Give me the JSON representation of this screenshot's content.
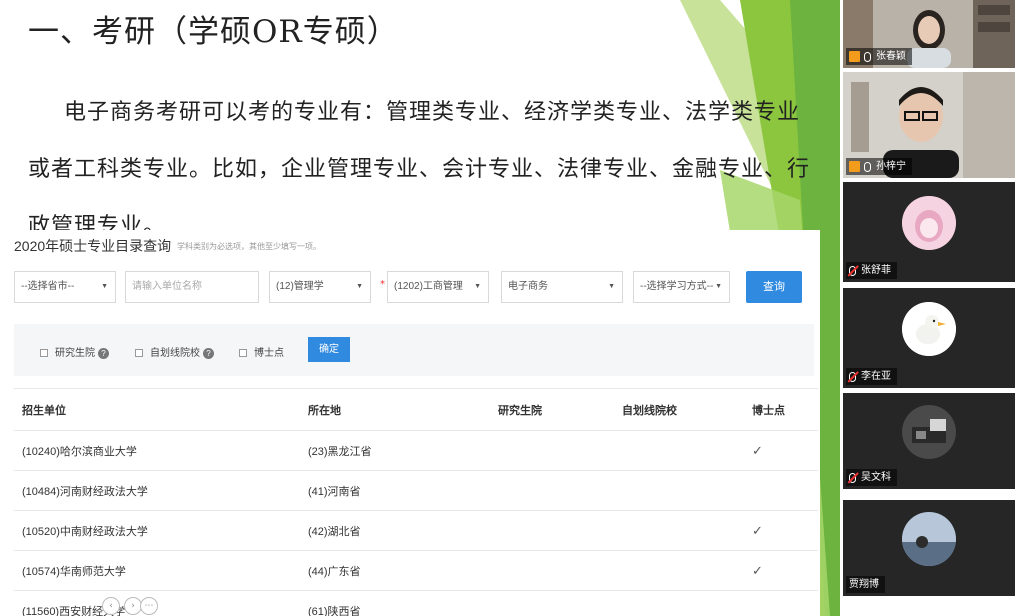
{
  "slide": {
    "title": "一、考研（学硕OR专硕）",
    "paragraph": "电子商务考研可以考的专业有：管理类专业、经济学类专业、法学类专业或者工科类专业。比如，企业管理专业、会计专业、法律专业、金融专业、行政管理专业。"
  },
  "webpage": {
    "title": "2020年硕士专业目录查询",
    "hint": "学科类别为必选项，其他至少填写一项。",
    "filters": {
      "province": "--选择省市--",
      "unit_placeholder": "请输入单位名称",
      "category": "(12)管理学",
      "discipline": "(1202)工商管理",
      "major": "电子商务",
      "study_mode": "--选择学习方式--",
      "query_label": "查询"
    },
    "checks": {
      "grad_school": "研究生院",
      "self_line": "自划线院校",
      "phd": "博士点",
      "confirm_label": "确定"
    },
    "table": {
      "headers": [
        "招生单位",
        "所在地",
        "研究生院",
        "自划线院校",
        "博士点"
      ],
      "rows": [
        {
          "unit": "(10240)哈尔滨商业大学",
          "location": "(23)黑龙江省",
          "phd": "✓"
        },
        {
          "unit": "(10484)河南财经政法大学",
          "location": "(41)河南省",
          "phd": ""
        },
        {
          "unit": "(10520)中南财经政法大学",
          "location": "(42)湖北省",
          "phd": "✓"
        },
        {
          "unit": "(10574)华南师范大学",
          "location": "(44)广东省",
          "phd": "✓"
        },
        {
          "unit": "(11560)西安财经大学",
          "location": "(61)陕西省",
          "phd": ""
        }
      ]
    }
  },
  "participants": [
    {
      "name": "张春颖",
      "type": "video"
    },
    {
      "name": "孙梓宁",
      "type": "video"
    },
    {
      "name": "张舒菲",
      "type": "avatar",
      "mic": "off"
    },
    {
      "name": "李在亚",
      "type": "avatar",
      "mic": "off"
    },
    {
      "name": "吴文科",
      "type": "avatar",
      "mic": "off"
    },
    {
      "name": "贾翔博",
      "type": "avatar"
    }
  ],
  "colors": {
    "accent_blue": "#2f8ae0",
    "deco_green": "#7dc142",
    "panel_tile": "#262626"
  }
}
